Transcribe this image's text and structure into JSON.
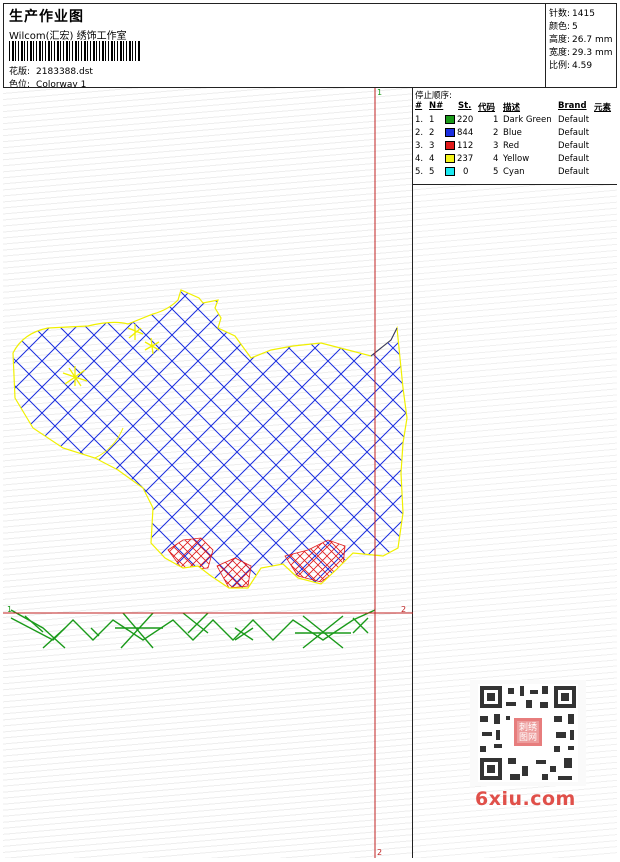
{
  "header": {
    "title": "生产作业图",
    "company": "Wilcom(汇宏) 绣饰工作室",
    "design_label": "花版:",
    "design_value": "2183388.dst",
    "colorway_label": "色位:",
    "colorway_value": "Colorway 1"
  },
  "stats": [
    {
      "label": "针数:",
      "value": "1415"
    },
    {
      "label": "颜色:",
      "value": "5"
    },
    {
      "label": "高度:",
      "value": "26.7 mm"
    },
    {
      "label": "宽度:",
      "value": "29.3 mm"
    },
    {
      "label": "比例:",
      "value": "4.59"
    }
  ],
  "stop_sequence": {
    "title": "停止顺序:",
    "columns": [
      "#",
      "N#",
      "St.",
      "代码",
      "描述",
      "Brand",
      "元素"
    ],
    "rows": [
      {
        "idx": "1.",
        "n": "1",
        "color": "#1a9a1a",
        "st": "220",
        "code": "1",
        "desc": "Dark Green",
        "brand": "Default"
      },
      {
        "idx": "2.",
        "n": "2",
        "color": "#1a2ee0",
        "st": "844",
        "code": "2",
        "desc": "Blue",
        "brand": "Default"
      },
      {
        "idx": "3.",
        "n": "3",
        "color": "#e01a1a",
        "st": "112",
        "code": "3",
        "desc": "Red",
        "brand": "Default"
      },
      {
        "idx": "4.",
        "n": "4",
        "color": "#f5f51a",
        "st": "237",
        "code": "4",
        "desc": "Yellow",
        "brand": "Default"
      },
      {
        "idx": "5.",
        "n": "5",
        "color": "#1ae8f0",
        "st": "0",
        "code": "5",
        "desc": "Cyan",
        "brand": "Default"
      }
    ]
  },
  "markers": {
    "v_top": "1",
    "v_bottom": "2",
    "h_left": "1",
    "h_right": "2"
  },
  "watermark": {
    "brand": "6xiu.com",
    "qr_caption": "刺绣图网"
  },
  "colors": {
    "green": "#1a9a1a",
    "blue": "#1a2ee0",
    "red": "#e01a1a",
    "yellow": "#f0f000",
    "guide": "#c02020"
  }
}
